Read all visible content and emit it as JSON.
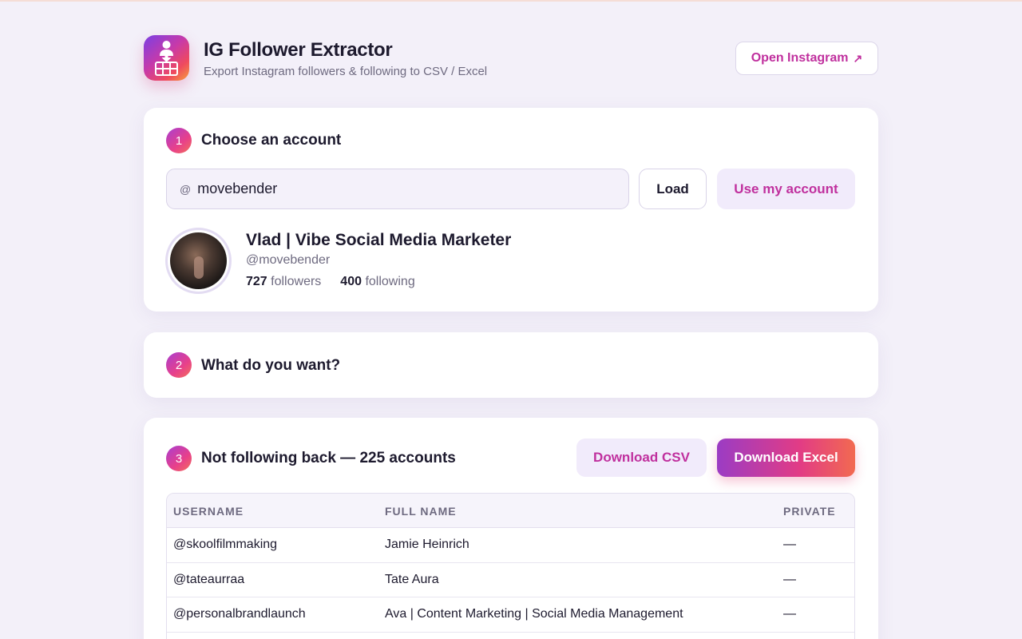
{
  "app": {
    "title": "IG Follower Extractor",
    "subtitle": "Export Instagram followers & following to CSV / Excel",
    "open_instagram": "Open Instagram",
    "open_icon": "↗"
  },
  "step1": {
    "num": "1",
    "title": "Choose an account",
    "at": "@",
    "input_value": "movebender",
    "load_label": "Load",
    "use_my_account_label": "Use my account"
  },
  "profile": {
    "name": "Vlad | Vibe Social Media Marketer",
    "handle": "@movebender",
    "followers_count": "727",
    "followers_label": "followers",
    "following_count": "400",
    "following_label": "following"
  },
  "step2": {
    "num": "2",
    "title": "What do you want?"
  },
  "step3": {
    "num": "3",
    "title": "Not following back — 225 accounts",
    "download_csv": "Download CSV",
    "download_excel": "Download Excel"
  },
  "table": {
    "headers": [
      "USERNAME",
      "FULL NAME",
      "PRIVATE"
    ],
    "rows": [
      [
        "@skoolfilmmaking",
        "Jamie Heinrich",
        "—"
      ],
      [
        "@tateaurraa",
        "Tate Aura",
        "—"
      ],
      [
        "@personalbrandlaunch",
        "Ava | Content Marketing | Social Media Management",
        "—"
      ]
    ]
  },
  "colors": {
    "accent": "#c0309e",
    "background": "#f3f0f9",
    "text": "#1d1a2e",
    "muted": "#6e6a80"
  }
}
